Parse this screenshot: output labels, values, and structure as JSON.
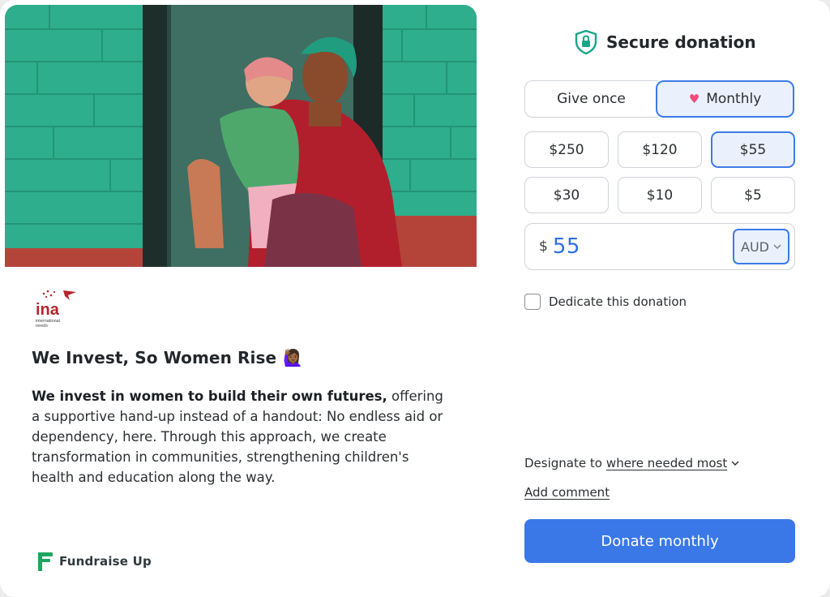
{
  "campaign": {
    "title": "We Invest, So Women Rise",
    "title_emoji": "🙋🏾‍♀️",
    "body_bold": "We invest in women to build their own futures,",
    "body_rest": " offering a supportive hand-up instead of a handout: No endless aid or dependency, here. Through this approach, we create transformation in communities, strengthening children's health and education along the way.",
    "org_logo_text": "ina",
    "org_logo_sub_1": "international",
    "org_logo_sub_2": "needs"
  },
  "brand": {
    "name": "Fundraise Up"
  },
  "form": {
    "title": "Secure donation",
    "frequency": {
      "once_label": "Give once",
      "monthly_label": "Monthly",
      "selected": "Monthly"
    },
    "amounts": [
      "$250",
      "$120",
      "$55",
      "$30",
      "$10",
      "$5"
    ],
    "selected_amount": "$55",
    "input": {
      "currency_symbol": "$",
      "value": "55",
      "currency": "AUD"
    },
    "dedicate_label": "Dedicate this donation",
    "designate_prefix": "Designate to",
    "designate_value": "where needed most",
    "add_comment": "Add comment",
    "submit_label": "Donate monthly"
  },
  "colors": {
    "accent": "#3b78e7",
    "selected_bg": "#eaf1fd",
    "shield": "#19a58a",
    "heart": "#f04a7a",
    "brand_green": "#1fa560",
    "logo_red": "#b5262f"
  },
  "icons": {
    "secure": "shield-lock-icon",
    "heart": "heart-icon",
    "chevron": "chevron-down-icon",
    "brand": "fundraise-up-logo-icon"
  }
}
